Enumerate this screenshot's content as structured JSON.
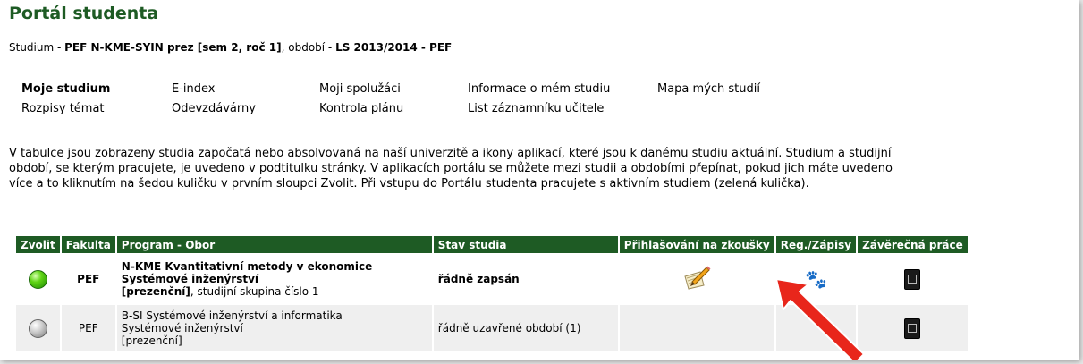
{
  "page": {
    "title": "Portál studenta",
    "subtitle_prefix": "Studium - ",
    "subtitle_study": "PEF N-KME-SYIN prez [sem 2, roč 1]",
    "subtitle_mid": ", období - ",
    "subtitle_period": "LS 2013/2014 - PEF"
  },
  "nav": {
    "items": [
      "Moje studium",
      "E-index",
      "Moji spolužáci",
      "Informace o mém studiu",
      "Mapa mých studií",
      "Rozpisy témat",
      "Odevzdávárny",
      "Kontrola plánu",
      "List záznamníku učitele"
    ],
    "active": "Moje studium"
  },
  "description": "V tabulce jsou zobrazeny studia započatá nebo absolvovaná na naší univerzitě a ikony aplikací, které jsou k danému studiu aktuální. Studium a studijní období, se kterým pracujete, je uvedeno v podtitulku stránky. V aplikacích portálu se můžete mezi studii a obdobími přepínat, pokud jich máte uvedeno více a to kliknutím na šedou kuličku v prvním sloupci Zvolit. Při vstupu do Portálu studenta pracujete s aktivním studiem (zelená kulička).",
  "table": {
    "headers": [
      "Zvolit",
      "Fakulta",
      "Program - Obor",
      "Stav studia",
      "Přihlašování na zkoušky",
      "Reg./Zápisy",
      "Závěrečná práce"
    ],
    "rows": [
      {
        "select": "green-ball-icon",
        "faculty": "PEF",
        "program": "N-KME Kvantitativní metody v ekonomice",
        "field": "Systémové inženýrství",
        "form": "[prezenční]",
        "group": ", studijní skupina číslo 1",
        "status": "řádně zapsán"
      },
      {
        "select": "gray-ball-icon",
        "faculty": "PEF",
        "program": "B-SI Systémové inženýrství a informatika",
        "field": "Systémové inženýrství",
        "form": "[prezenční]",
        "status": "řádně uzavřené období (1)"
      }
    ]
  },
  "colors": {
    "brand_green": "#1e5b24",
    "arrow_red": "#e8261b"
  },
  "icons": [
    "green-ball-icon",
    "gray-ball-icon",
    "exam-pencil-icon",
    "paw-prints-icon",
    "thesis-book-icon",
    "red-arrow-icon"
  ]
}
